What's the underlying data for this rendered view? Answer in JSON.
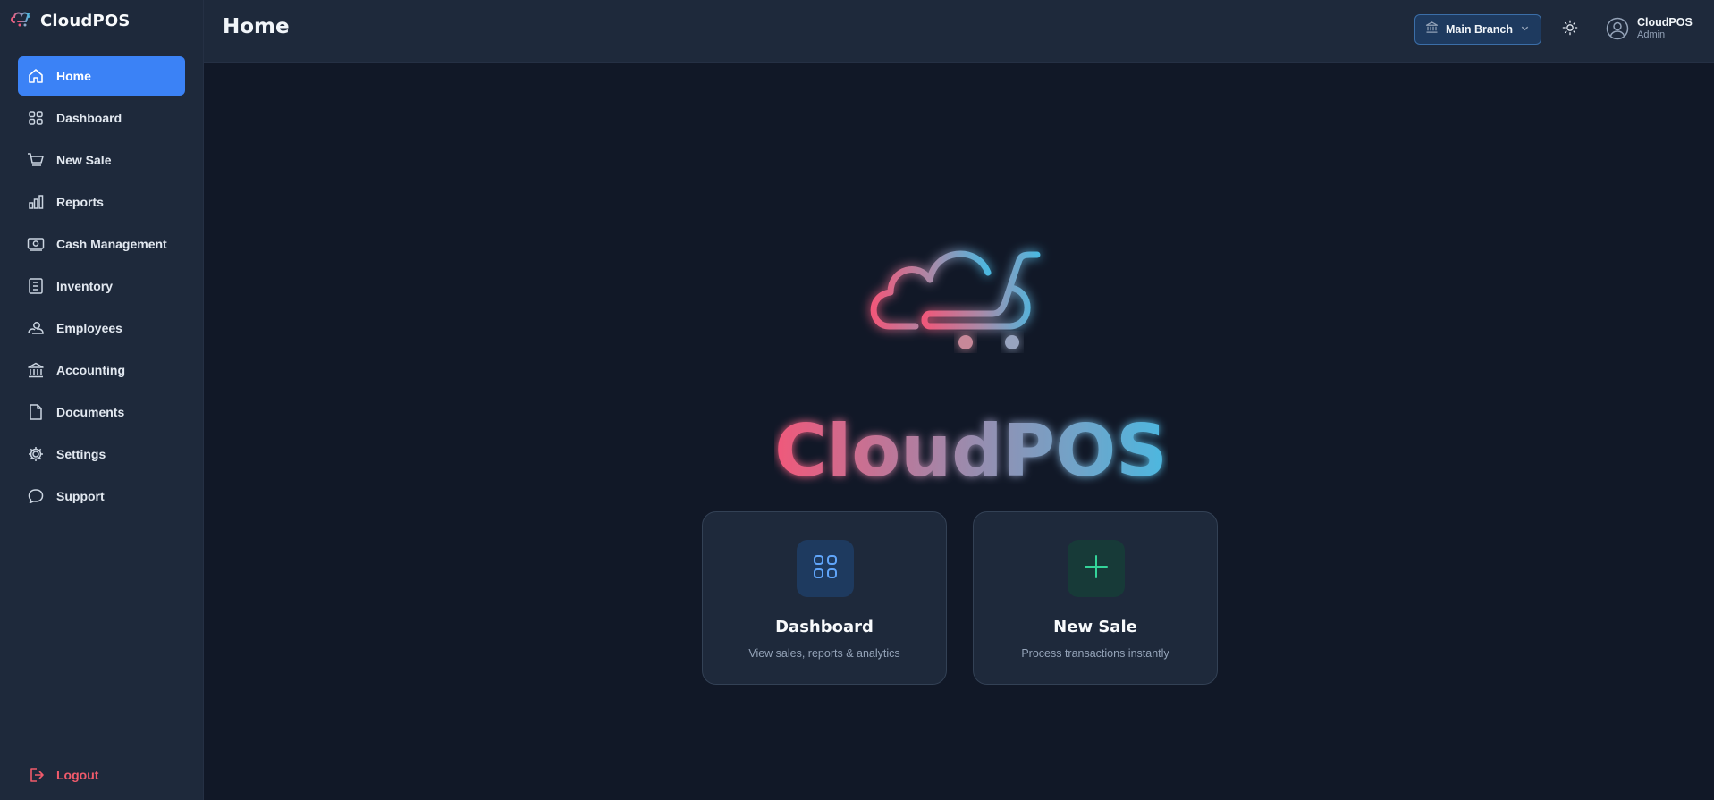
{
  "app": {
    "name": "CloudPOS"
  },
  "sidebar": {
    "items": [
      {
        "label": "Home",
        "icon": "home-icon",
        "active": true
      },
      {
        "label": "Dashboard",
        "icon": "grid-icon"
      },
      {
        "label": "New Sale",
        "icon": "cart-icon"
      },
      {
        "label": "Reports",
        "icon": "bar-chart-icon"
      },
      {
        "label": "Cash Management",
        "icon": "cash-icon"
      },
      {
        "label": "Inventory",
        "icon": "list-icon"
      },
      {
        "label": "Employees",
        "icon": "employees-icon"
      },
      {
        "label": "Accounting",
        "icon": "bank-icon"
      },
      {
        "label": "Documents",
        "icon": "document-icon"
      },
      {
        "label": "Settings",
        "icon": "gear-icon"
      },
      {
        "label": "Support",
        "icon": "chat-bubble-icon"
      }
    ],
    "logout": {
      "label": "Logout",
      "icon": "logout-icon"
    }
  },
  "header": {
    "title": "Home",
    "branch": {
      "selected": "Main Branch",
      "icon": "bank-icon"
    },
    "theme_toggle": {
      "icon": "sun-icon"
    },
    "user": {
      "name": "CloudPOS",
      "role": "Admin",
      "icon": "user-circle-icon"
    }
  },
  "hero": {
    "brand": "CloudPOS"
  },
  "cards": [
    {
      "title": "Dashboard",
      "subtitle": "View sales, reports & analytics",
      "icon": "grid-icon",
      "accent": "#60a5fa"
    },
    {
      "title": "New Sale",
      "subtitle": "Process transactions instantly",
      "icon": "plus-icon",
      "accent": "#34d399"
    }
  ],
  "colors": {
    "accent": "#3b82f6",
    "logout": "#f05a6b",
    "brand_pink": "#f0587a",
    "brand_blue": "#4cb8e0"
  }
}
